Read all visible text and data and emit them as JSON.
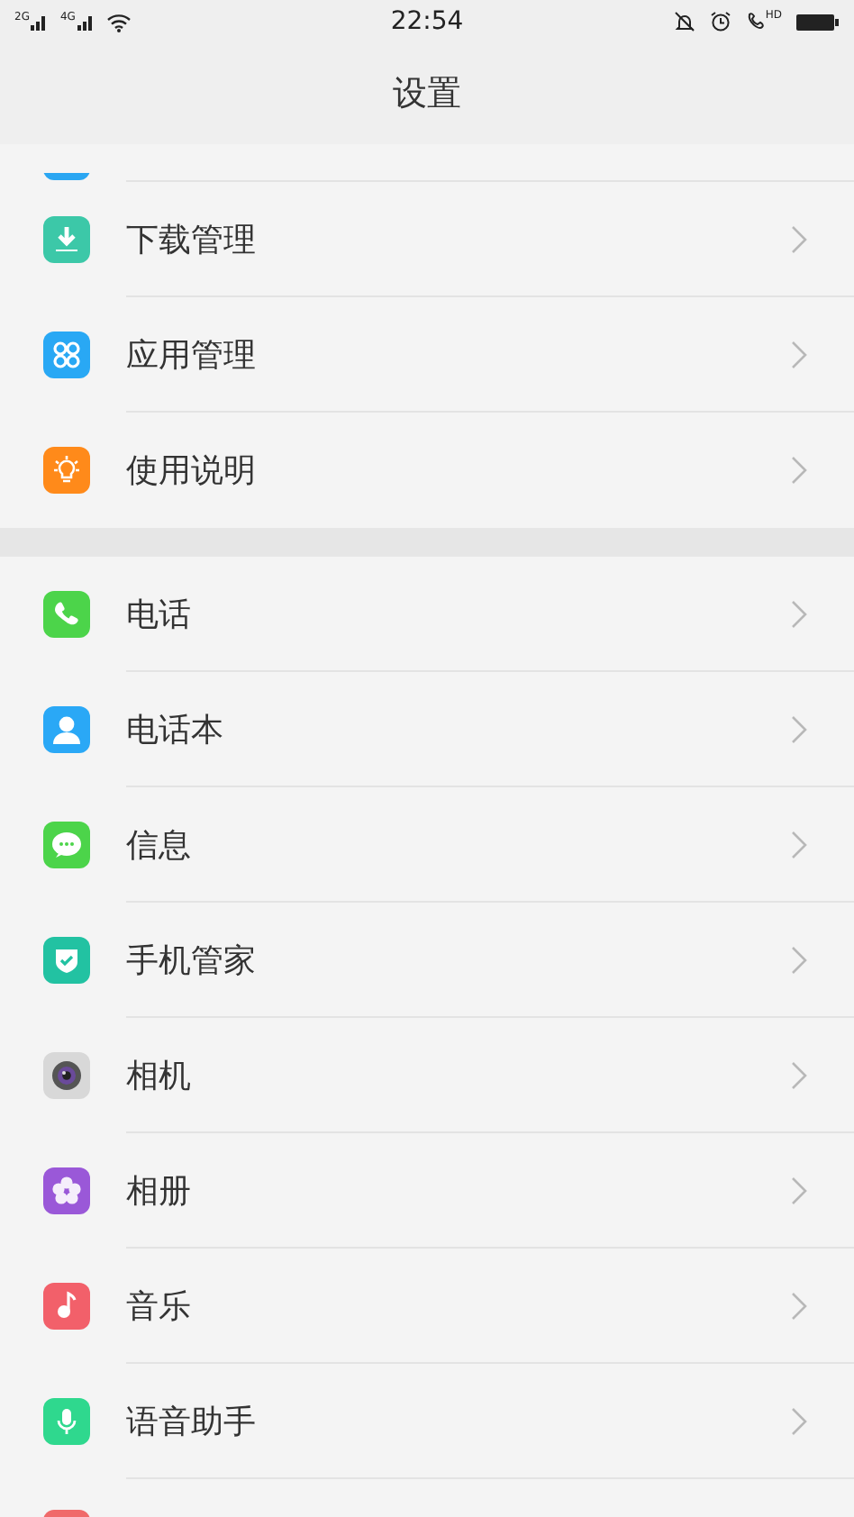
{
  "status_bar": {
    "networks": [
      "2G",
      "4G"
    ],
    "time": "22:54",
    "call_badge": "HD"
  },
  "title": "设置",
  "sections": [
    {
      "items": [
        {
          "kind": "cut-top",
          "color": "#2aa6f2"
        },
        {
          "kind": "row",
          "label": "下载管理",
          "color": "#3cc8a8"
        },
        {
          "kind": "row",
          "label": "应用管理",
          "color": "#29a8f4"
        },
        {
          "kind": "row",
          "label": "使用说明",
          "color": "#ff8a1a"
        }
      ]
    },
    {
      "items": [
        {
          "kind": "row",
          "label": "电话",
          "color": "#4cd44a"
        },
        {
          "kind": "row",
          "label": "电话本",
          "color": "#2aa8f6"
        },
        {
          "kind": "row",
          "label": "信息",
          "color": "#4cd44a"
        },
        {
          "kind": "row",
          "label": "手机管家",
          "color": "#22c2a2"
        },
        {
          "kind": "row",
          "label": "相机",
          "color": "#d8d8d8"
        },
        {
          "kind": "row",
          "label": "相册",
          "color": "#9a58d8"
        },
        {
          "kind": "row",
          "label": "音乐",
          "color": "#f2606a"
        },
        {
          "kind": "row",
          "label": "语音助手",
          "color": "#2fd88e"
        },
        {
          "kind": "cut-bottom",
          "color": "#f06a6a"
        }
      ]
    }
  ]
}
